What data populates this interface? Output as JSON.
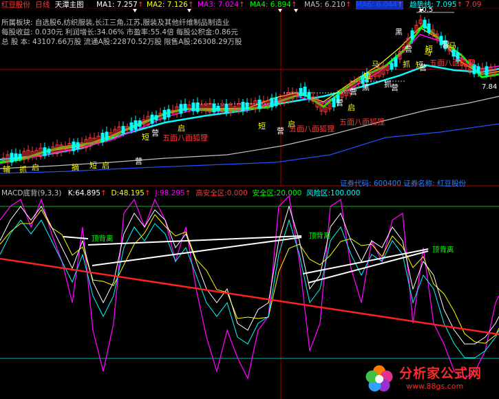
{
  "header": {
    "stock_name": "红豆股份",
    "period": "日线",
    "chart_name": "天潭主图",
    "ma": [
      {
        "label": "MA1:",
        "value": "7.257",
        "arrow": "↑",
        "color": "#ffffff"
      },
      {
        "label": "MA2:",
        "value": "7.126",
        "arrow": "↑",
        "color": "#ffff00"
      },
      {
        "label": "MA3:",
        "value": "7.024",
        "arrow": "↑",
        "color": "#ff00ff"
      },
      {
        "label": "MA4:",
        "value": "6.894",
        "arrow": "↑",
        "color": "#00ff00"
      },
      {
        "label": "MA5:",
        "value": "6.210",
        "arrow": "↑",
        "color": "#c0c0c0"
      },
      {
        "label": "MA6:",
        "value": "6.044",
        "arrow": "↑",
        "color": "#2050ff"
      },
      {
        "label": "趋势线:",
        "value": "7.095",
        "arrow": "↑",
        "color": "#00ffff"
      },
      {
        "label": "",
        "value": "7.09",
        "arrow": "",
        "color": "#ff3b3b"
      }
    ]
  },
  "info": {
    "line1": "所属板块:  自选股6,纺织服装,长江三角,江苏,服装及其他纤维制品制造业",
    "line2": "每股收益:  0.030元    利润增长:34.06%    市盈率:55.4倍    每股公积金:0.86元",
    "line3": "总 股 本:  43107.66万股   流通A股:22870.52万股   限售A股:26308.29万股"
  },
  "stock_code_line": "证券代码: 600400 证券名称: 红豆股份",
  "price_scale": [
    "10.5",
    "7.84"
  ],
  "candle_labels": {
    "fuzhu": [
      {
        "t": "辅",
        "c": "#ffff00"
      },
      {
        "t": "抓",
        "c": "#ffff00"
      },
      {
        "t": "启",
        "c": "#ffff00"
      },
      {
        "t": "摘",
        "c": "#ffff00"
      },
      {
        "t": "短",
        "c": "#ffff00"
      },
      {
        "t": "启",
        "c": "#ffff00"
      },
      {
        "t": "营",
        "c": "#ffffff"
      },
      {
        "t": "短",
        "c": "#ffff00"
      },
      {
        "t": "营",
        "c": "#ffffff"
      },
      {
        "t": "启",
        "c": "#ffff00"
      },
      {
        "t": "短",
        "c": "#ffff00"
      },
      {
        "t": "营",
        "c": "#ffffff"
      },
      {
        "t": "启",
        "c": "#ffff00"
      },
      {
        "t": "营",
        "c": "#ffffff"
      },
      {
        "t": "启",
        "c": "#ffff00"
      },
      {
        "t": "营",
        "c": "#ffffff"
      },
      {
        "t": "黑",
        "c": "#ffffff"
      },
      {
        "t": "短",
        "c": "#ffff00"
      },
      {
        "t": "马",
        "c": "#ffff00"
      },
      {
        "t": "抓",
        "c": "#ffffff"
      },
      {
        "t": "营",
        "c": "#ffffff"
      },
      {
        "t": "抓",
        "c": "#ffff00"
      },
      {
        "t": "营",
        "c": "#ffffff"
      },
      {
        "t": "短",
        "c": "#ffff00"
      },
      {
        "t": "马",
        "c": "#ffff00"
      },
      {
        "t": "营",
        "c": "#ffffff"
      },
      {
        "t": "短",
        "c": "#ffff00"
      },
      {
        "t": "营",
        "c": "#ffffff"
      },
      {
        "t": "马",
        "c": "#ffff00"
      },
      {
        "t": "黑",
        "c": "#ffffff"
      }
    ],
    "signals": [
      {
        "t": "五面八面狐狸",
        "c": "#ff3b3b"
      },
      {
        "t": "五面八面狐狸",
        "c": "#ff3b3b"
      },
      {
        "t": "五面八面狐狸",
        "c": "#ff3b3b"
      },
      {
        "t": "五面八面狐狸",
        "c": "#ff3b3b"
      }
    ]
  },
  "macd_header": {
    "name": "MACD底背",
    "params": "(9,3,3)",
    "k_label": "K:",
    "k_value": "64.895",
    "d_label": "D:",
    "d_value": "48.195",
    "j_label": "J:",
    "j_value": "98.295",
    "high_label": "高安全区:",
    "high_value": "0.000",
    "safe_label": "安全区:",
    "safe_value": "20.000",
    "risk_label": "风险区:",
    "risk_value": "100.000",
    "arrow": "↑"
  },
  "divergence_labels": [
    "顶背离",
    "顶背离",
    "顶背离"
  ],
  "watermark": {
    "site": "分析家公式网",
    "url": "www.88gs.com"
  },
  "colors": {
    "background": "#000000",
    "up": "#ff3b3b",
    "down": "#00ffff",
    "divider": "#b00000",
    "k_line": "#ffffff",
    "d_line": "#ffff00",
    "j_line": "#ff00ff",
    "trend_line": "#ff2020",
    "divergence_line": "#ffffff",
    "label_green": "#00ff00"
  }
}
